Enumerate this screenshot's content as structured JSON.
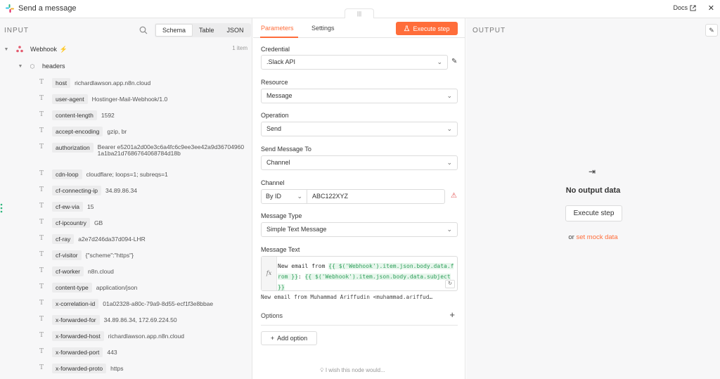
{
  "header": {
    "title": "Send a message",
    "docs_label": "Docs",
    "close_label": "✕"
  },
  "input": {
    "label": "INPUT",
    "view_tabs": [
      "Schema",
      "Table",
      "JSON"
    ],
    "active_view": "Schema",
    "node_name": "Webhook",
    "item_count": "1 item",
    "group_name": "headers",
    "fields": [
      {
        "key": "host",
        "value": "richardlawson.app.n8n.cloud"
      },
      {
        "key": "user-agent",
        "value": "Hostinger-Mail-Webhook/1.0"
      },
      {
        "key": "content-length",
        "value": "1592"
      },
      {
        "key": "accept-encoding",
        "value": "gzip, br"
      },
      {
        "key": "authorization",
        "value": "Bearer e5201a2d00e3c6a4fc6c9ee3ee42a9d367049601a1ba21d7686764068784d18b"
      },
      {
        "key": "cdn-loop",
        "value": "cloudflare; loops=1; subreqs=1"
      },
      {
        "key": "cf-connecting-ip",
        "value": "34.89.86.34"
      },
      {
        "key": "cf-ew-via",
        "value": "15"
      },
      {
        "key": "cf-ipcountry",
        "value": "GB"
      },
      {
        "key": "cf-ray",
        "value": "a2e7d246da37d094-LHR"
      },
      {
        "key": "cf-visitor",
        "value": "{\"scheme\":\"https\"}"
      },
      {
        "key": "cf-worker",
        "value": "n8n.cloud"
      },
      {
        "key": "content-type",
        "value": "application/json"
      },
      {
        "key": "x-correlation-id",
        "value": "01a02328-a80c-79a9-8d55-ecf1f3e8bbae"
      },
      {
        "key": "x-forwarded-for",
        "value": "34.89.86.34, 172.69.224.50"
      },
      {
        "key": "x-forwarded-host",
        "value": "richardlawson.app.n8n.cloud"
      },
      {
        "key": "x-forwarded-port",
        "value": "443"
      },
      {
        "key": "x-forwarded-proto",
        "value": "https"
      }
    ]
  },
  "params": {
    "tabs": [
      "Parameters",
      "Settings"
    ],
    "active_tab": "Parameters",
    "execute_label": "Execute step",
    "credential_label": "Credential",
    "credential_value": ".Slack API",
    "resource_label": "Resource",
    "resource_value": "Message",
    "operation_label": "Operation",
    "operation_value": "Send",
    "send_to_label": "Send Message To",
    "send_to_value": "Channel",
    "channel_label": "Channel",
    "channel_mode": "By ID",
    "channel_value": "ABC122XYZ",
    "message_type_label": "Message Type",
    "message_type_value": "Simple Text Message",
    "message_text_label": "Message Text",
    "message_text_plain": "New email from ",
    "message_text_expr1": "{{ $('Webhook').item.json.body.data.from }}",
    "message_text_sep": ": ",
    "message_text_expr2": "{{ $('Webhook').item.json.body.data.subject }}",
    "message_preview": "New email from  Muhammad Ariffudin <muhammad.ariffud…",
    "options_label": "Options",
    "add_option_label": "Add option",
    "wish_text": "I wish this node would..."
  },
  "output": {
    "label": "OUTPUT",
    "empty_title": "No output data",
    "execute_label": "Execute step",
    "mock_prefix": "or ",
    "mock_link": "set mock data"
  },
  "colors": {
    "accent": "#ff6d3a",
    "panel_bg": "#f7f7f8",
    "expression_green": "#2e9f5a",
    "warning_red": "#e14c4c"
  }
}
